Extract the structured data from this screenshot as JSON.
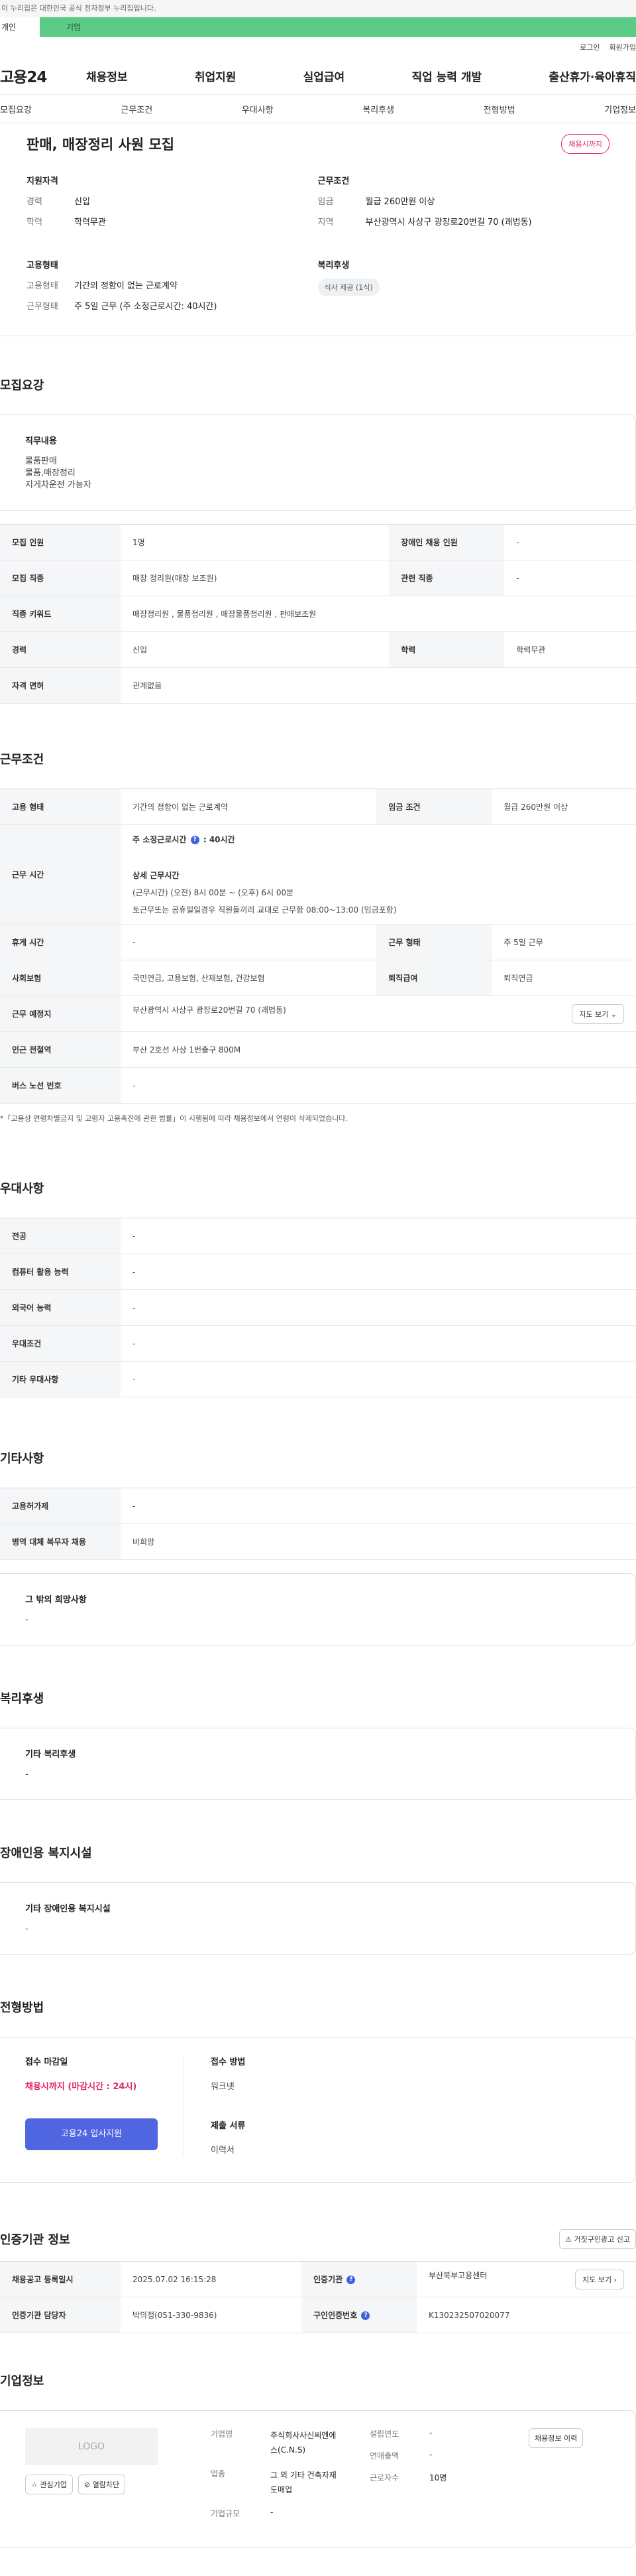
{
  "gov_notice": "이 누리집은 대한민국 공식 전자정부 누리집입니다.",
  "top_tabs": {
    "individual": "개인",
    "business": "기업"
  },
  "util": [
    "로그인",
    "회원가입"
  ],
  "logo": "고용24",
  "gnb": [
    "채용정보",
    "취업지원",
    "실업급여",
    "직업 능력 개발",
    "출산휴가·육아휴직"
  ],
  "subnav": [
    "모집요강",
    "근무조건",
    "우대사항",
    "복리후생",
    "전형방법",
    "기업정보"
  ],
  "job": {
    "title": "판매, 매장정리 사원 모집",
    "status": "채용시까지"
  },
  "summary": {
    "qual_h": "지원자격",
    "career_k": "경력",
    "career_v": "신입",
    "edu_k": "학력",
    "edu_v": "학력무관",
    "cond_h": "근무조건",
    "wage_k": "임금",
    "wage_v": "월급 260만원 이상",
    "region_k": "지역",
    "region_v": "부산광역시 사상구 광장로20번길 70 (괘법동)",
    "type_h": "고용형태",
    "etype_k": "고용형태",
    "etype_v": "기간의 정함이 없는 근로계약",
    "hours_k": "근무형태",
    "hours_v": "주 5일 근무 (주 소정근로시간: 40시간)",
    "welfare_h": "복리후생",
    "welfare_v": "식사 제공 (1식)"
  },
  "recruit": {
    "h": "모집요강",
    "duty_h": "직무내용",
    "duty_lines": [
      "물품판매",
      "물품,매장정리",
      "지게차운전 가능자"
    ],
    "rows": [
      [
        "모집 인원",
        "1명",
        "장애인 채용 인원",
        "-"
      ],
      [
        "모집 직종",
        "매장 정리원(매장 보조원)",
        "관련 직종",
        "-"
      ],
      [
        "직종 키워드",
        "매장정리원 , 물품정리원 , 매장물품정리원 , 판매보조원",
        "",
        ""
      ],
      [
        "경력",
        "신입",
        "학력",
        "학력무관"
      ],
      [
        "자격 면허",
        "관계없음",
        "",
        ""
      ]
    ]
  },
  "work": {
    "h": "근무조건",
    "etype_k": "고용 형태",
    "etype_v": "기간의 정함이 없는 근로계약",
    "wage_k": "임금 조건",
    "wage_v": "월급 260만원 이상",
    "time_k": "근무 시간",
    "time_sub": "주 소정근로시간",
    "time_hours": "40시간",
    "detail_h": "상세 근무시간",
    "detail_1": "(근무시간) (오전) 8시 00분 ~ (오후) 6시 00분",
    "detail_2": "토근무또는 공휴일일경우 직원들끼리 교대로 근무함  08:00~13:00 (임금포함)",
    "rest_k": "휴게 시간",
    "rest_v": "-",
    "form_k": "근무 형태",
    "form_v": "주 5일 근무",
    "ins_k": "사회보험",
    "ins_v": "국민연금, 고용보험, 산재보험, 건강보험",
    "ret_k": "퇴직급여",
    "ret_v": "퇴직연금",
    "place_k": "근무 예정지",
    "place_v": "부산광역시 사상구 광장로20번길 70 (괘법동)",
    "map_btn": "지도 보기",
    "subway_k": "인근 전철역",
    "subway_v": "부산 2호선 사상 1번출구 800M",
    "bus_k": "버스 노선 번호",
    "bus_v": "-",
    "note": "*「고용상 연령차별금지 및 고령자 고용촉진에 관한 법률」이 시행됨에 따라 채용정보에서 연령이 삭제되었습니다."
  },
  "pref": {
    "h": "우대사항",
    "rows": [
      [
        "전공",
        "-"
      ],
      [
        "컴퓨터 활용 능력",
        "-"
      ],
      [
        "외국어 능력",
        "-"
      ],
      [
        "우대조건",
        "-"
      ],
      [
        "기타 우대사항",
        "-"
      ]
    ]
  },
  "etc": {
    "h": "기타사항",
    "rows": [
      [
        "고용허가제",
        "-"
      ],
      [
        "병역 대체 복무자 채용",
        "비희망"
      ]
    ],
    "box_h": "그 밖의 희망사항",
    "box_v": "-"
  },
  "welfare": {
    "h": "복리후생",
    "box_h": "기타 복리후생",
    "box_v": "-"
  },
  "disab": {
    "h": "장애인용 복지시설",
    "box_h": "기타 장애인용 복지시설",
    "box_v": "-"
  },
  "apply": {
    "h": "전형방법",
    "deadline_h": "접수 마감일",
    "deadline_v": "채용시까지 (마감시간 : 24시)",
    "method_h": "접수 방법",
    "method_v": "워크넷",
    "docs_h": "제출 서류",
    "docs_v": "이력서",
    "btn": "고용24 입사지원"
  },
  "cert": {
    "h": "인증기관 정보",
    "report_btn": "거짓구인광고 신고",
    "reg_k": "채용공고 등록일시",
    "reg_v": "2025.07.02 16:15:28",
    "agency_k": "인증기관",
    "agency_v": "부산북부고용센터",
    "map_btn": "지도 보기",
    "mgr_k": "인증기관 담당자",
    "mgr_v": "박의정(051-330-9836)",
    "num_k": "구인인증번호",
    "num_v": "K130232507020077"
  },
  "company": {
    "h": "기업정보",
    "logo": "LOGO",
    "fav_btn": "관심기업",
    "block_btn": "열람차단",
    "name_k": "기업명",
    "name_v": "주식회사사신씨엔에스(C.N.S)",
    "ind_k": "업종",
    "ind_v": "그 외 기타 건축자재 도매업",
    "size_k": "기업규모",
    "size_v": "-",
    "year_k": "설립연도",
    "year_v": "-",
    "sales_k": "연매출액",
    "sales_v": "-",
    "emp_k": "근로자수",
    "emp_v": "10명",
    "history_btn": "채용정보 이력"
  }
}
